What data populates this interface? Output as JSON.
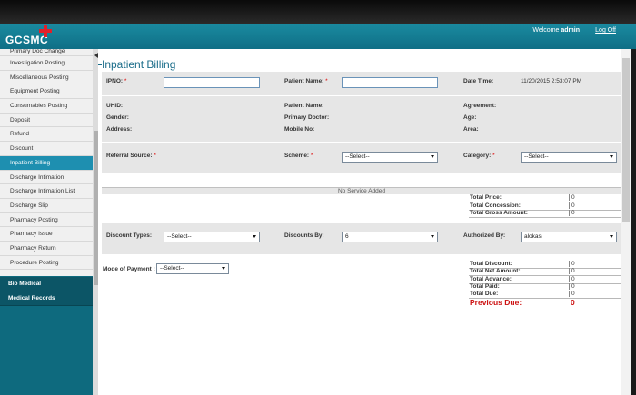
{
  "header": {
    "logo_text": "GCSMC",
    "welcome_prefix": "Welcome",
    "username": "admin",
    "logoff_label": "Log Off"
  },
  "sidebar": {
    "items": [
      "Primary Doc Change",
      "Investigation Posting",
      "Miscellaneous Posting",
      "Equipment Posting",
      "Consumables Posting",
      "Deposit",
      "Refund",
      "Discount",
      "Inpatient Billing",
      "Discharge Intimation",
      "Discharge Intimation List",
      "Discharge Slip",
      "Pharmacy Posting",
      "Pharmacy Issue",
      "Pharmacy Return",
      "Procedure Posting"
    ],
    "active_item": "Inpatient Billing",
    "sections": [
      "Bio Medical",
      "Medical Records"
    ]
  },
  "page": {
    "title": "Inpatient Billing"
  },
  "form": {
    "ipno_label": "IPNO:",
    "patient_name_label": "Patient Name:",
    "datetime_label": "Date Time:",
    "datetime_value": "11/20/2015 2:53:07 PM",
    "required_mark": "*",
    "uhid_label": "UHID:",
    "gender_label": "Gender:",
    "address_label": "Address:",
    "patient_name2_label": "Patient Name:",
    "primary_doctor_label": "Primary Doctor:",
    "mobile_label": "Mobile No:",
    "agreement_label": "Agreement:",
    "age_label": "Age:",
    "area_label": "Area:",
    "referral_label": "Referral Source:",
    "scheme_label": "Scheme:",
    "scheme_value": "--Select--",
    "category_label": "Category:",
    "category_value": "--Select--"
  },
  "services": {
    "empty_text": "No Service Added",
    "totals": [
      {
        "label": "Total Price:",
        "value": "0"
      },
      {
        "label": "Total Concession:",
        "value": "0"
      },
      {
        "label": "Total Gross Amount:",
        "value": "0"
      }
    ]
  },
  "discount": {
    "types_label": "Discount Types:",
    "types_value": "--Select--",
    "by_label": "Discounts By:",
    "by_value": "6",
    "authorized_label": "Authorized By:",
    "authorized_value": "alokas"
  },
  "payment": {
    "mode_label": "Mode of Payment :",
    "mode_value": "--Select--",
    "totals": [
      {
        "label": "Total Discount:",
        "value": "0"
      },
      {
        "label": "Total Net Amount:",
        "value": "0"
      },
      {
        "label": "Total Advance:",
        "value": "0"
      },
      {
        "label": "Total Paid:",
        "value": "0"
      },
      {
        "label": "Total Due:",
        "value": "0"
      }
    ],
    "previous_due_label": "Previous Due:",
    "previous_due_value": "0"
  },
  "colors": {
    "header": "#0f6f86",
    "active": "#1e8fb0",
    "title": "#1b6d8a",
    "due": "#cc1111"
  }
}
